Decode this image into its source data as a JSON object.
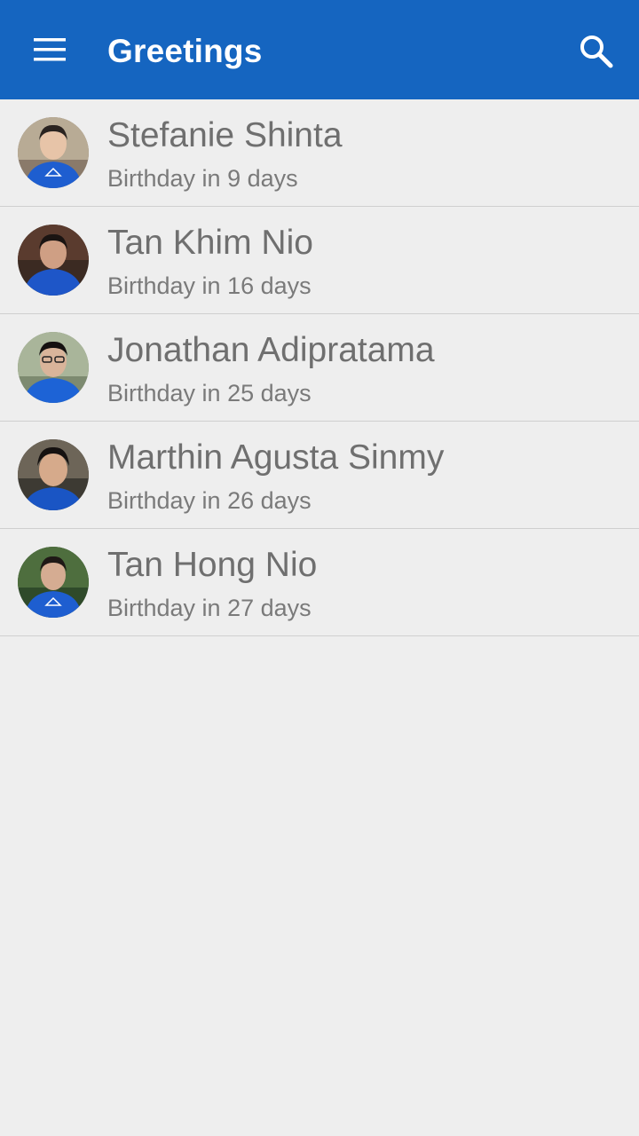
{
  "toolbar": {
    "title": "Greetings",
    "menu_icon": "hamburger-menu-icon",
    "search_icon": "search-icon",
    "color": "#1565c0"
  },
  "contacts": [
    {
      "name": "Stefanie Shinta",
      "subtitle": "Birthday in 9 days"
    },
    {
      "name": "Tan Khim Nio",
      "subtitle": "Birthday in 16 days"
    },
    {
      "name": "Jonathan Adipratama",
      "subtitle": "Birthday in 25 days"
    },
    {
      "name": "Marthin Agusta Sinmy",
      "subtitle": "Birthday in 26 days"
    },
    {
      "name": "Tan Hong Nio",
      "subtitle": "Birthday in 27 days"
    }
  ]
}
